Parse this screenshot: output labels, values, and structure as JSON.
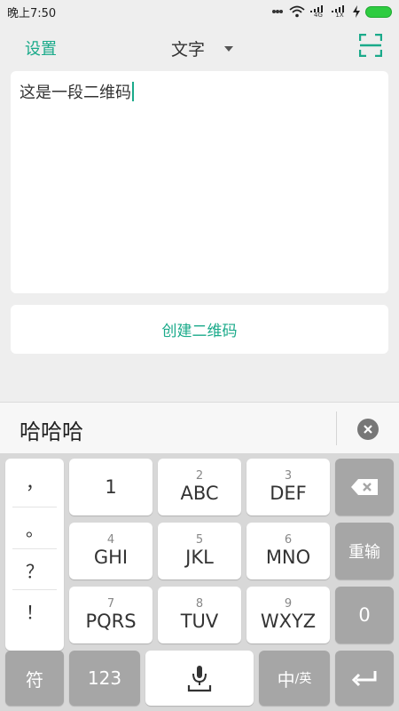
{
  "status_bar": {
    "time": "晚上7:50",
    "net_top": "4G",
    "net_bottom": "1X"
  },
  "header": {
    "settings": "设置",
    "mode": "文字"
  },
  "editor": {
    "text": "这是一段二维码"
  },
  "create_button": "创建二维码",
  "candidate": {
    "text": "哈哈哈"
  },
  "keyboard": {
    "punct": [
      "，",
      "。",
      "？",
      "！"
    ],
    "keys": [
      {
        "num": "",
        "letters": "1"
      },
      {
        "num": "2",
        "letters": "ABC"
      },
      {
        "num": "3",
        "letters": "DEF"
      },
      {
        "num": "4",
        "letters": "GHI"
      },
      {
        "num": "5",
        "letters": "JKL"
      },
      {
        "num": "6",
        "letters": "MNO"
      },
      {
        "num": "7",
        "letters": "PQRS"
      },
      {
        "num": "8",
        "letters": "TUV"
      },
      {
        "num": "9",
        "letters": "WXYZ"
      }
    ],
    "retype": "重输",
    "zero": "0",
    "symbols": "符",
    "numeric": "123",
    "lang_main": "中",
    "lang_sub": "/英"
  },
  "colors": {
    "accent": "#1aaa8a",
    "battery": "#2ecc40"
  }
}
